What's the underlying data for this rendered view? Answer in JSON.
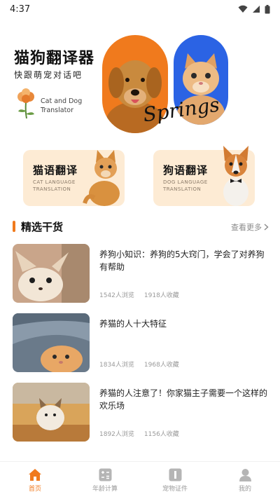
{
  "status_bar": {
    "time": "4:37",
    "icons": [
      "wifi-icon",
      "signal-icon",
      "battery-icon"
    ]
  },
  "hero": {
    "title": "猫狗翻译器",
    "subtitle": "快跟萌宠对话吧",
    "en_line1": "Cat and Dog",
    "en_line2": "Translator",
    "script_text": "Springs"
  },
  "cards": {
    "cat": {
      "title": "猫语翻译",
      "en_line1": "CAT LANGUAGE",
      "en_line2": "TRANSLATION"
    },
    "dog": {
      "title": "狗语翻译",
      "en_line1": "DOG LANGUAGE",
      "en_line2": "TRANSLATION"
    }
  },
  "section": {
    "title": "精选干货",
    "more": "查看更多"
  },
  "articles": [
    {
      "title": "养狗小知识：养狗的5大窍门，学会了对养狗有帮助",
      "views": "1542人浏览",
      "favorites": "1918人收藏"
    },
    {
      "title": "养猫的人十大特征",
      "views": "1834人浏览",
      "favorites": "1968人收藏"
    },
    {
      "title": "养猫的人注意了！你家猫主子需要一个这样的欢乐场",
      "views": "1892人浏览",
      "favorites": "1156人收藏"
    }
  ],
  "bottom_nav": [
    {
      "label": "首页",
      "icon": "home-icon",
      "active": true
    },
    {
      "label": "年龄计算",
      "icon": "calculator-icon",
      "active": false
    },
    {
      "label": "宠物证件",
      "icon": "id-card-icon",
      "active": false
    },
    {
      "label": "我的",
      "icon": "person-icon",
      "active": false
    }
  ],
  "colors": {
    "accent": "#f07a1d",
    "blue": "#2b63e4",
    "card_bg": "#fdebd4"
  }
}
